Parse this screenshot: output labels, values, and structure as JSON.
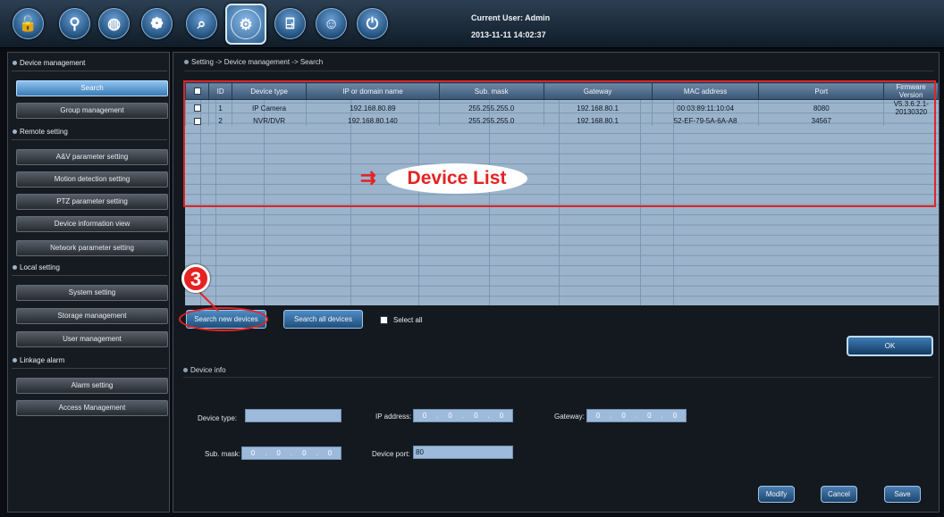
{
  "toolbar": {
    "icons": [
      "lock-icon",
      "map-pin-icon",
      "globe-icon",
      "film-reel-icon",
      "search-window-icon",
      "settings-icon",
      "exit-door-icon",
      "face-icon",
      "power-icon"
    ],
    "user_label": "Current User: Admin",
    "datetime": "2013-11-11 14:02:37"
  },
  "sidebar": {
    "sections": [
      "Device management",
      "Remote setting",
      "Local setting",
      "Linkage alarm"
    ],
    "device_management": [
      "Search",
      "Group management"
    ],
    "remote_setting": [
      "A&V parameter setting",
      "Motion detection setting",
      "PTZ parameter setting",
      "Device information view",
      "Network parameter setting"
    ],
    "local_setting": [
      "System setting",
      "Storage management",
      "User management"
    ],
    "linkage_alarm": [
      "Alarm setting",
      "Access Management"
    ],
    "active_item": "Search"
  },
  "breadcrumb": "Setting -> Device management -> Search",
  "table": {
    "columns": [
      "",
      "ID",
      "Device type",
      "IP or domain name",
      "Sub. mask",
      "Gateway",
      "MAC address",
      "Port",
      "Firmware Version"
    ],
    "rows": [
      [
        "1",
        "IP Camera",
        "192.168.80.89",
        "255.255.255.0",
        "192.168.80.1",
        "00:03:89:11:10:04",
        "8080",
        "V5.3.6.2.1-20130320"
      ],
      [
        "2",
        "NVR/DVR",
        "192.168.80.140",
        "255.255.255.0",
        "192.168.80.1",
        "52-EF-79-5A-6A-A8",
        "34567",
        ""
      ]
    ]
  },
  "annotation": {
    "label": "Device List",
    "step": "3"
  },
  "actions": {
    "search_new": "Search new devices",
    "search_all": "Search all devices",
    "select_all": "Select all",
    "ok": "OK"
  },
  "device_info": {
    "title": "Device info",
    "type_label": "Device type:",
    "type_value": "",
    "ip_label": "IP address:",
    "ip": [
      "0",
      "0",
      "0",
      "0"
    ],
    "gateway_label": "Gateway:",
    "gateway": [
      "0",
      "0",
      "0",
      "0"
    ],
    "mask_label": "Sub. mask:",
    "mask": [
      "0",
      "0",
      "0",
      "0"
    ],
    "port_label": "Device port:",
    "port_value": "80"
  },
  "footer": {
    "modify": "Modify",
    "cancel": "Cancel",
    "save": "Save"
  },
  "colors": {
    "accent": "#3c7ab2",
    "annotation": "#e02424",
    "grid": "#9bb4cc"
  }
}
